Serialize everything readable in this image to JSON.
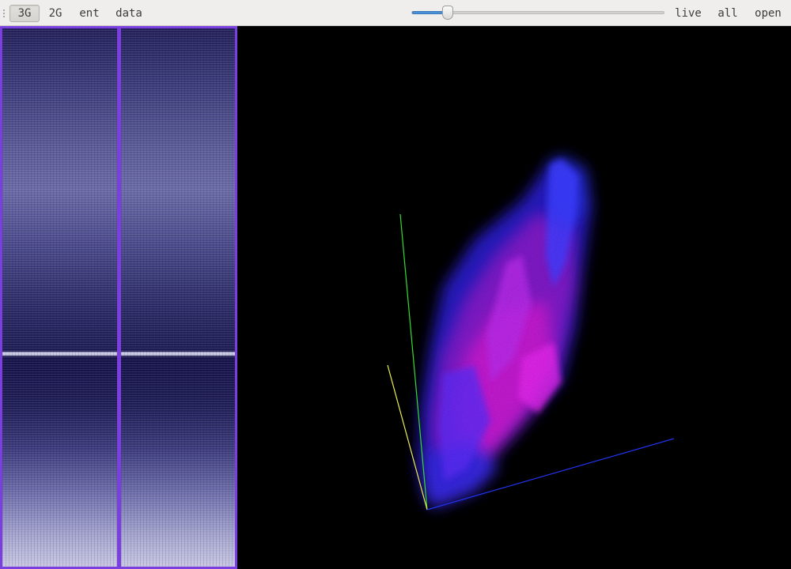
{
  "toolbar": {
    "grip_icon": "drag-grip-icon",
    "buttons": [
      {
        "label": "3G",
        "active": true
      },
      {
        "label": "2G",
        "active": false
      },
      {
        "label": "ent",
        "active": false
      },
      {
        "label": "data",
        "active": false
      }
    ],
    "slider": {
      "value_fraction": 0.14
    },
    "right_buttons": [
      {
        "label": "live"
      },
      {
        "label": "all"
      },
      {
        "label": "open"
      }
    ]
  },
  "colors": {
    "panel_border": "#7b3fe0",
    "axis_x": "#2233ee",
    "axis_y": "#33dd33",
    "axis_z": "#eeee55",
    "cloud_magenta": "#c21fd6",
    "cloud_blue": "#3a22ee"
  }
}
